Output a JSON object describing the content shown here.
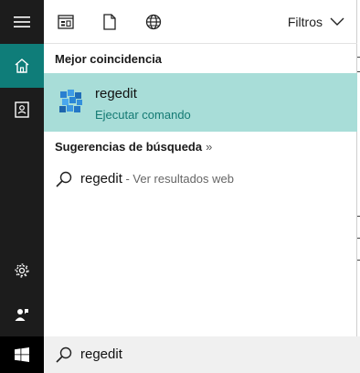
{
  "rail": {
    "icons": [
      "hamburger-menu-icon",
      "home-icon",
      "notebook-icon",
      "settings-icon",
      "feedback-icon",
      "windows-start-icon"
    ],
    "accent": "#0f7d79"
  },
  "toolbar": {
    "icons": [
      "apps-filter-icon",
      "documents-filter-icon",
      "web-filter-icon"
    ],
    "filters_label": "Filtros"
  },
  "best_match": {
    "header": "Mejor coincidencia",
    "name": "regedit",
    "subtitle": "Ejecutar comando",
    "highlight": "#a8ddd8"
  },
  "suggestions": {
    "header": "Sugerencias de búsqueda",
    "header_chevron": "»",
    "items": [
      {
        "query": "regedit",
        "hint": " - Ver resultados web"
      }
    ]
  },
  "search": {
    "value": "regedit"
  }
}
